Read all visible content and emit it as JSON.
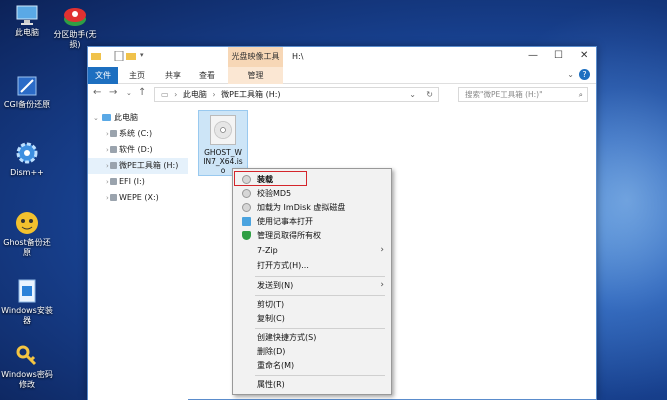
{
  "desktop": {
    "icons": [
      {
        "label": "此电脑",
        "icon": "computer-icon"
      },
      {
        "label": "分区助手(无损)",
        "icon": "partition-assistant-icon"
      },
      {
        "label": "CGI备份还原",
        "icon": "cgi-backup-icon"
      },
      {
        "label": "Dism++",
        "icon": "dism-gear-icon"
      },
      {
        "label": "Ghost备份还原",
        "icon": "ghost-icon"
      },
      {
        "label": "Windows安装器",
        "icon": "windows-installer-icon"
      },
      {
        "label": "Windows密码修改",
        "icon": "key-icon"
      }
    ]
  },
  "window": {
    "context_tab": "光盘映像工具",
    "title_path": "H:\\",
    "ribbon_tabs": [
      "文件",
      "主页",
      "共享",
      "查看",
      "管理"
    ],
    "address": {
      "parts": [
        "此电脑",
        "微PE工具箱 (H:)"
      ]
    },
    "search_placeholder": "搜索\"微PE工具箱 (H:)\"",
    "nav_tree": [
      {
        "label": "此电脑"
      },
      {
        "label": "系统 (C:)"
      },
      {
        "label": "软件 (D:)"
      },
      {
        "label": "微PE工具箱 (H:)"
      },
      {
        "label": "EFI (I:)"
      },
      {
        "label": "WEPE (X:)"
      }
    ],
    "file": {
      "name": "GHOST_WIN7_X64.iso",
      "name_lines": [
        "GHOST_W",
        "IN7_X64.is",
        "o"
      ]
    }
  },
  "context_menu": {
    "groups": [
      [
        {
          "label": "装载",
          "icon": "disc-icon"
        },
        {
          "label": "校验MD5",
          "icon": "disc-icon"
        },
        {
          "label": "加载为 ImDisk 虚拟磁盘",
          "icon": "disc-icon"
        },
        {
          "label": "使用记事本打开",
          "icon": "notepad-icon"
        },
        {
          "label": "管理员取得所有权",
          "icon": "shield-icon"
        },
        {
          "label": "7-Zip",
          "submenu": true
        },
        {
          "label": "打开方式(H)..."
        }
      ],
      [
        {
          "label": "发送到(N)",
          "submenu": true
        }
      ],
      [
        {
          "label": "剪切(T)"
        },
        {
          "label": "复制(C)"
        }
      ],
      [
        {
          "label": "创建快捷方式(S)"
        },
        {
          "label": "删除(D)"
        },
        {
          "label": "重命名(M)"
        }
      ],
      [
        {
          "label": "属性(R)"
        }
      ]
    ]
  },
  "colors": {
    "accent": "#1d6fc0",
    "highlight": "#d4252b",
    "context_tab": "#f7d7b6"
  }
}
